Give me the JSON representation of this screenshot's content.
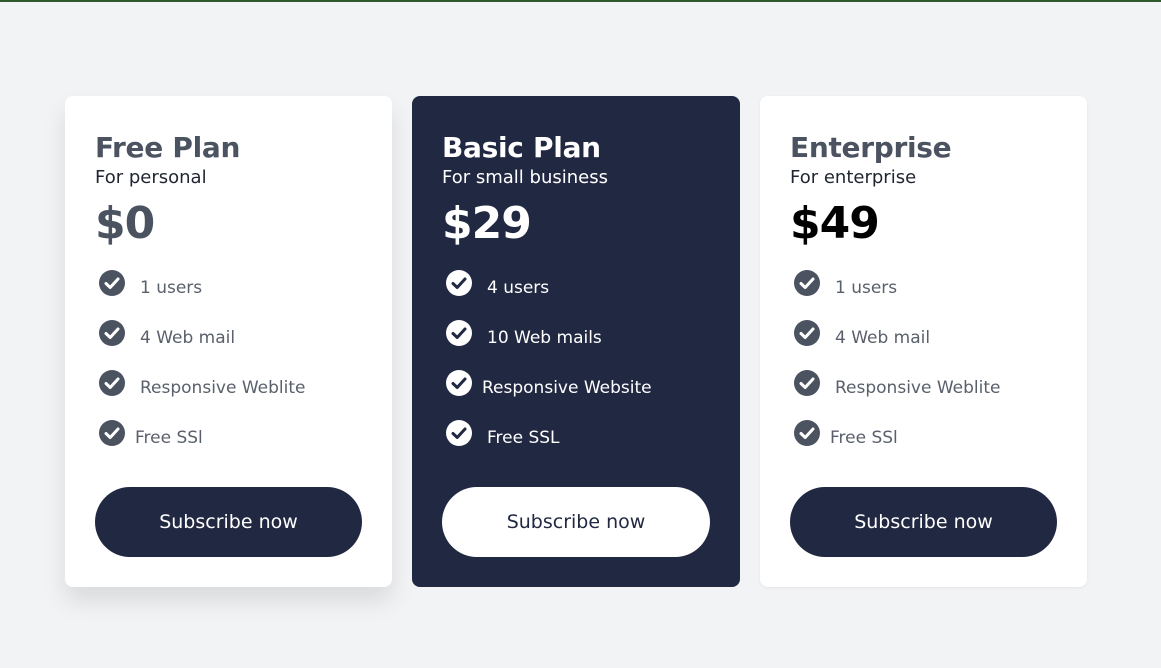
{
  "plans": [
    {
      "title": "Free Plan",
      "subtitle": "For personal",
      "price": "$0",
      "features": [
        "1 users",
        "4 Web mail",
        "Responsive Weblite",
        "Free SSl"
      ],
      "button": "Subscribe now"
    },
    {
      "title": "Basic Plan",
      "subtitle": "For small business",
      "price": "$29",
      "features": [
        "4 users",
        "10 Web mails",
        "Responsive Website",
        "Free SSL"
      ],
      "button": "Subscribe now"
    },
    {
      "title": "Enterprise",
      "subtitle": "For enterprise",
      "price": "$49",
      "features": [
        "1 users",
        "4 Web mail",
        "Responsive Weblite",
        "Free SSl"
      ],
      "button": "Subscribe now"
    }
  ],
  "colors": {
    "background": "#f2f3f5",
    "dark_navy": "#212842",
    "text_gray": "#4b5260"
  },
  "icons": {
    "feature_check": "check-circle-icon"
  }
}
